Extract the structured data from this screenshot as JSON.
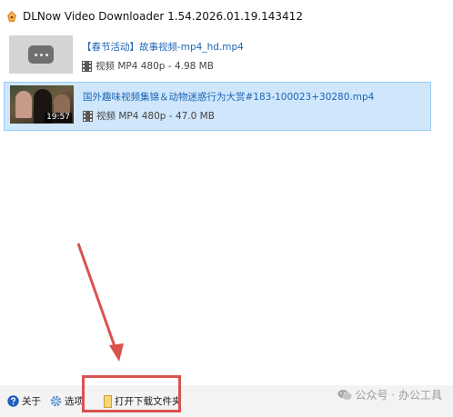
{
  "window": {
    "title": "DLNow Video Downloader 1.54.2026.01.19.143412"
  },
  "files": [
    {
      "title": "【春节活动】故事视频-mp4_hd.mp4",
      "type_label": "视频",
      "format": "MP4 480p",
      "size": "4.98 MB",
      "duration": "",
      "selected": false
    },
    {
      "title": "国外趣味视频集锦＆动物迷惑行为大赏#183-100023+30280.mp4",
      "type_label": "视频",
      "format": "MP4 480p",
      "size": "47.0 MB",
      "duration": "19:57",
      "selected": true
    }
  ],
  "bottom_bar": {
    "about_label": "关于",
    "options_label": "选项",
    "open_folder_label": "打开下载文件夹"
  },
  "watermark": {
    "text": "公众号 · 办公工具"
  },
  "colors": {
    "accent": "#1c65b5",
    "selection": "#cfe6fb",
    "highlight": "#d9534f"
  }
}
